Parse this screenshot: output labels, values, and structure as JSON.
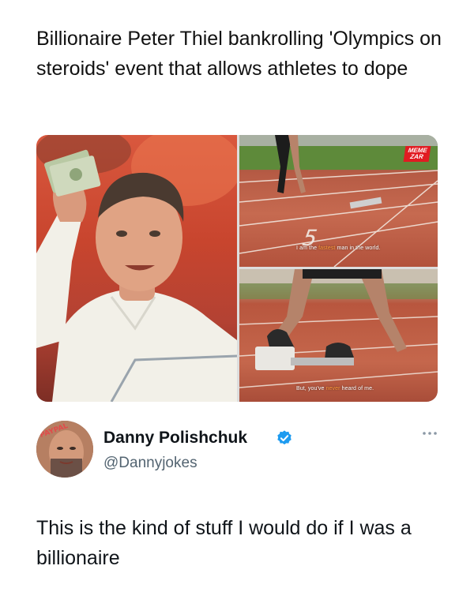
{
  "headline": "Billionaire Peter Thiel bankrolling 'Olympics on steroids' event that allows athletes to dope",
  "media": {
    "badge_line1": "MEME",
    "badge_line2": "ZAR",
    "caption_top_pre": "I am the ",
    "caption_top_hl": "fastest",
    "caption_top_post": " man in the world.",
    "caption_bottom_pre": "But, you've ",
    "caption_bottom_hl": "never",
    "caption_bottom_post": " heard of me.",
    "lane_number": "5",
    "avatar_scribble": "PAYPAL"
  },
  "tweet": {
    "display_name": "Danny Polishchuk",
    "handle": "@Dannyjokes",
    "verified": true,
    "text": "This is the kind of stuff I would do if I was a billionaire"
  },
  "colors": {
    "verified_blue": "#1d9bf0",
    "handle_gray": "#536471",
    "badge_red": "#e11b22"
  },
  "icons": {
    "verified": "verified-badge-icon",
    "more": "more-options-icon"
  }
}
